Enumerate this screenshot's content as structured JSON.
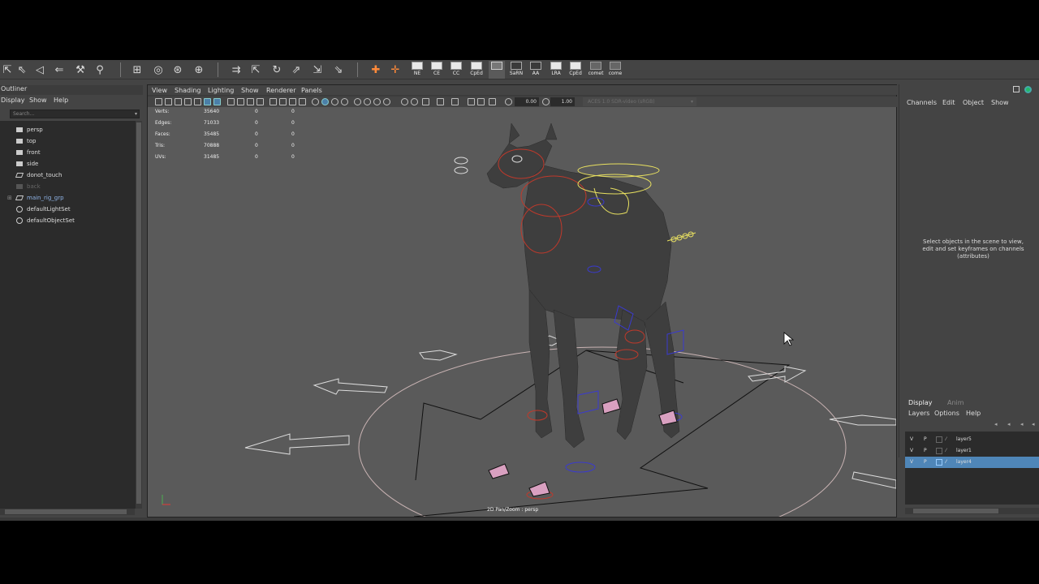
{
  "shelf": {
    "buttons": [
      {
        "label": "NE",
        "icon": "shelf-ne-icon"
      },
      {
        "label": "CE",
        "icon": "shelf-ce-icon"
      },
      {
        "label": "CC",
        "icon": "shelf-cc-icon"
      },
      {
        "label": "CpEd",
        "icon": "shelf-cped-icon"
      },
      {
        "label": "SaRN",
        "icon": "shelf-sarn-icon"
      },
      {
        "label": "AA",
        "icon": "shelf-aa-icon"
      },
      {
        "label": "LRA",
        "icon": "shelf-lra-icon"
      },
      {
        "label": "CpEd",
        "icon": "shelf-cped2-icon"
      },
      {
        "label": "comet",
        "icon": "shelf-comet-icon"
      },
      {
        "label": "come",
        "icon": "shelf-come-icon"
      }
    ]
  },
  "outliner": {
    "title": "Outliner",
    "menu": [
      "Display",
      "Show",
      "Help"
    ],
    "search_placeholder": "Search...",
    "items": [
      {
        "label": "persp",
        "type": "camera"
      },
      {
        "label": "top",
        "type": "camera"
      },
      {
        "label": "front",
        "type": "camera"
      },
      {
        "label": "side",
        "type": "camera"
      },
      {
        "label": "donot_touch",
        "type": "group"
      },
      {
        "label": "back",
        "type": "camera",
        "dim": true
      },
      {
        "label": "main_rig_grp",
        "type": "group",
        "expandable": true
      },
      {
        "label": "defaultLightSet",
        "type": "set"
      },
      {
        "label": "defaultObjectSet",
        "type": "set"
      }
    ]
  },
  "viewport": {
    "menu": [
      "View",
      "Shading",
      "Lighting",
      "Show",
      "Renderer",
      "Panels"
    ],
    "exposure": "0.00",
    "gamma": "1.00",
    "color_space": "ACES 1.0 SDR-video (sRGB)",
    "hud": [
      {
        "label": "Verts:",
        "value": "35640",
        "sel": "0",
        "comp": "0"
      },
      {
        "label": "Edges:",
        "value": "71033",
        "sel": "0",
        "comp": "0"
      },
      {
        "label": "Faces:",
        "value": "35485",
        "sel": "0",
        "comp": "0"
      },
      {
        "label": "Tris:",
        "value": "70888",
        "sel": "0",
        "comp": "0"
      },
      {
        "label": "UVs:",
        "value": "31485",
        "sel": "0",
        "comp": "0"
      }
    ],
    "camera_label": "2D Pan/Zoom : persp"
  },
  "channel_box": {
    "menu": [
      "Channels",
      "Edit",
      "Object",
      "Show"
    ],
    "info": [
      "Select objects in the scene to view,",
      "edit and set keyframes on channels",
      "(attributes)"
    ]
  },
  "layer_editor": {
    "tabs": [
      "Display",
      "Anim"
    ],
    "active_tab": "Display",
    "menu": [
      "Layers",
      "Options",
      "Help"
    ],
    "layers": [
      {
        "v": "V",
        "p": "P",
        "name": "layer5",
        "selected": false
      },
      {
        "v": "V",
        "p": "P",
        "name": "layer1",
        "selected": false
      },
      {
        "v": "V",
        "p": "P",
        "name": "layer4",
        "selected": true
      }
    ]
  },
  "colors": {
    "viewport_bg": "#5a5a5a",
    "panel_bg": "#444444",
    "selection": "#4f86b8",
    "rig_red": "#c0392b",
    "rig_blue": "#3a3ad0",
    "rig_yellow": "#e8e060"
  }
}
